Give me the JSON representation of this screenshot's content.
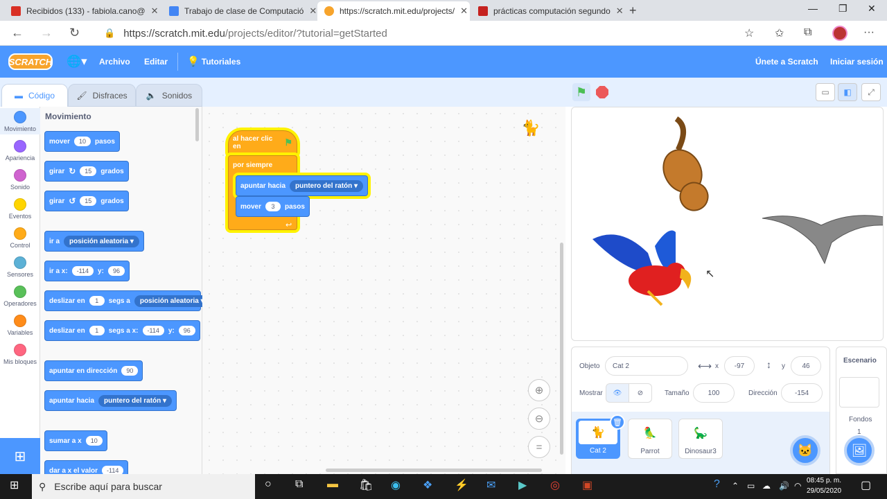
{
  "browser": {
    "tabs": [
      {
        "title": "Recibidos (133) - fabiola.cano@",
        "icon": "gmail-icon",
        "color": "#d93025"
      },
      {
        "title": "Trabajo de clase de Computació",
        "icon": "classroom-icon",
        "color": "#4285f4"
      },
      {
        "title": "https://scratch.mit.edu/projects/",
        "icon": "scratch-favicon",
        "color": "#f7a42c"
      },
      {
        "title": "prácticas computación segundo",
        "icon": "pdf-icon",
        "color": "#c5221f"
      }
    ],
    "url_prefix": "https://scratch.mit.edu",
    "url_path": "/projects/editor/?tutorial=getStarted"
  },
  "menu": {
    "logo": "SCRATCH",
    "file": "Archivo",
    "edit": "Editar",
    "tutorials": "Tutoriales",
    "join": "Únete a Scratch",
    "signin": "Iniciar sesión"
  },
  "tabs": {
    "code": "Código",
    "costumes": "Disfraces",
    "sounds": "Sonidos"
  },
  "categories": [
    {
      "label": "Movimiento",
      "color": "#4c97ff"
    },
    {
      "label": "Apariencia",
      "color": "#9966ff"
    },
    {
      "label": "Sonido",
      "color": "#cf63cf"
    },
    {
      "label": "Eventos",
      "color": "#ffd500"
    },
    {
      "label": "Control",
      "color": "#ffab19"
    },
    {
      "label": "Sensores",
      "color": "#5cb1d6"
    },
    {
      "label": "Operadores",
      "color": "#59c059"
    },
    {
      "label": "Variables",
      "color": "#ff8c1a"
    },
    {
      "label": "Mis bloques",
      "color": "#ff6680"
    }
  ],
  "palette": {
    "title": "Movimiento",
    "move": {
      "label": "mover",
      "value": "10",
      "suffix": "pasos"
    },
    "turn_right": {
      "label": "girar",
      "value": "15",
      "suffix": "grados"
    },
    "turn_left": {
      "label": "girar",
      "value": "15",
      "suffix": "grados"
    },
    "goto": {
      "label": "ir a",
      "option": "posición aleatoria"
    },
    "goto_xy": {
      "label": "ir a x:",
      "x": "-114",
      "ylabel": "y:",
      "y": "96"
    },
    "glide": {
      "label": "deslizar en",
      "value": "1",
      "mid": "segs a",
      "option": "posición aleatoria"
    },
    "glide_xy": {
      "label": "deslizar en",
      "value": "1",
      "mid": "segs a x:",
      "x": "-114",
      "ylabel": "y:",
      "y": "96"
    },
    "point_dir": {
      "label": "apuntar en dirección",
      "value": "90"
    },
    "point_towards": {
      "label": "apuntar hacia",
      "option": "puntero del ratón"
    },
    "change_x": {
      "label": "sumar a x",
      "value": "10"
    },
    "set_x": {
      "label": "dar a x el valor",
      "value": "-114"
    }
  },
  "script": {
    "hat": "al hacer clic en",
    "forever": "por siempre",
    "point_label": "apuntar hacia",
    "point_option": "puntero del ratón",
    "move_label": "mover",
    "move_value": "3",
    "move_suffix": "pasos"
  },
  "sprite_info": {
    "name_label": "Objeto",
    "name": "Cat 2",
    "x_label": "x",
    "x": "-97",
    "y_label": "y",
    "y": "46",
    "show_label": "Mostrar",
    "size_label": "Tamaño",
    "size": "100",
    "dir_label": "Dirección",
    "direction": "-154"
  },
  "sprites": [
    {
      "name": "Cat 2",
      "selected": true
    },
    {
      "name": "Parrot",
      "selected": false
    },
    {
      "name": "Dinosaur3",
      "selected": false
    }
  ],
  "stage_pane": {
    "title": "Escenario",
    "backdrops_label": "Fondos",
    "backdrops_count": "1"
  },
  "taskbar": {
    "search": "Escribe aquí para buscar",
    "time": "08:45 p. m.",
    "date": "29/05/2020"
  }
}
